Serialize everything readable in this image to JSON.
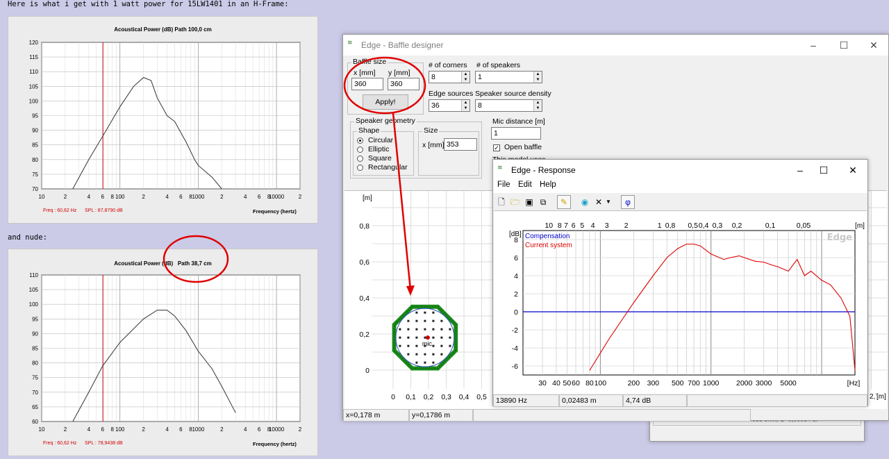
{
  "post": {
    "intro": "Here is what i get with 1 watt power for 15LW1401 in an H-Frame:",
    "nude_label": "and nude:"
  },
  "plot1": {
    "title": "Acoustical Power (dB)   Path 100,0 cm",
    "caption_freq": "Freq : 60,62 Hz",
    "caption_spl": "SPL : 87,8790 dB",
    "xlabel": "Frequency (hertz)",
    "y_ticks": [
      "120",
      "115",
      "110",
      "105",
      "100",
      "95",
      "90",
      "85",
      "80",
      "75",
      "70"
    ],
    "x_ticks": [
      "10",
      "2",
      "4",
      "6",
      "8",
      "100",
      "2",
      "4",
      "6",
      "8",
      "1000",
      "2",
      "4",
      "6",
      "8",
      "10000",
      "2"
    ]
  },
  "plot2": {
    "title_pre": "Acoustical Power (",
    "title_mid": "dB)",
    "title_post": "Path 38,7 cm",
    "caption_freq": "Freq : 60,62 Hz",
    "caption_spl": "SPL : 78,9438 dB",
    "xlabel": "Frequency (hertz)",
    "y_ticks": [
      "110",
      "105",
      "100",
      "95",
      "90",
      "85",
      "80",
      "75",
      "70",
      "65",
      "60"
    ],
    "x_ticks": [
      "10",
      "2",
      "4",
      "6",
      "8",
      "100",
      "2",
      "4",
      "6",
      "8",
      "1000",
      "2",
      "4",
      "6",
      "8",
      "10000",
      "2"
    ]
  },
  "baffle": {
    "title": "Edge - Baffle designer",
    "baffle_size": "Baffle size",
    "x_label": "x [mm]",
    "y_label": "y [mm]",
    "x_value": "360",
    "y_value": "360",
    "apply": "Apply!",
    "corners_label": "# of corners",
    "corners_value": "8",
    "speakers_label": "# of speakers",
    "speakers_value": "1",
    "edge_sources_label": "Edge sources",
    "edge_sources_value": "36",
    "density_label": "Speaker source density",
    "density_value": "8",
    "geometry_label": "Speaker geometry",
    "shape_label": "Shape",
    "shapes": [
      "Circular",
      "Elliptic",
      "Square",
      "Rectangular"
    ],
    "size_label": "Size",
    "size_x_label": "x [mm]",
    "size_x_value": "353",
    "mic_distance_label": "Mic distance [m]",
    "mic_distance_value": "1",
    "open_baffle_label": "Open baffle",
    "model_note": "This model uses",
    "y_axis_unit": "[m]",
    "y_ticks": [
      "0,8",
      "0,6",
      "0,4",
      "0,2",
      "0"
    ],
    "x_ticks": [
      "0",
      "0,1",
      "0,2",
      "0,3",
      "0,4",
      "0,5"
    ],
    "mic_label": "mic",
    "x_right_tick": "2,7",
    "x_unit": "[m]",
    "status_x": "x=0,178 m",
    "status_y": "y=0,1786 m",
    "behind_text": "R2=140088 ohm, C=0,00084 uF",
    "behind_num": "1"
  },
  "response": {
    "title": "Edge - Response",
    "menu": [
      "File",
      "Edit",
      "Help"
    ],
    "legend": [
      "Compensation",
      "Current system"
    ],
    "watermark": "Edge",
    "y_unit": "[dB]",
    "y_ticks": [
      "8",
      "6",
      "4",
      "2",
      "0",
      "-2",
      "-4",
      "-6"
    ],
    "top_unit": "[m]",
    "top_ticks": [
      "10",
      "8",
      "7",
      "6",
      "5",
      "4",
      "3",
      "2",
      "1",
      "0,8",
      "0,5",
      "0,4",
      "0,3",
      "0,2",
      "0,1",
      "0,05"
    ],
    "x_ticks": [
      "30",
      "40",
      "50",
      "60",
      "80",
      "100",
      "200",
      "300",
      "500",
      "700",
      "1000",
      "2000",
      "3000",
      "5000"
    ],
    "x_unit": "[Hz]",
    "status_freq": "13890 Hz",
    "status_dist": "0,02483 m",
    "status_db": "4,74 dB",
    "colors": {
      "compensation": "#0000cc",
      "current": "#dd0000"
    }
  },
  "chart_data": [
    {
      "type": "line",
      "title": "Acoustical Power (dB)   Path 100,0 cm",
      "xlabel": "Frequency (hertz)",
      "ylim": [
        70,
        120
      ],
      "xlim": [
        10,
        20000
      ],
      "x_scale": "log",
      "series": [
        {
          "x": [
            25,
            40,
            60,
            100,
            150,
            200,
            250,
            300,
            400,
            500,
            700,
            900,
            1000,
            1500,
            2000
          ],
          "values": [
            70,
            80,
            87.9,
            98,
            105,
            108,
            107,
            101,
            95,
            93,
            86,
            80,
            78,
            74,
            70
          ]
        }
      ]
    },
    {
      "type": "line",
      "title": "Acoustical Power (dB)   Path 38,7 cm",
      "xlabel": "Frequency (hertz)",
      "ylim": [
        60,
        110
      ],
      "xlim": [
        10,
        20000
      ],
      "x_scale": "log",
      "series": [
        {
          "x": [
            25,
            40,
            60,
            100,
            200,
            300,
            400,
            500,
            700,
            1000,
            1500,
            2000,
            3000
          ],
          "values": [
            60,
            70,
            78.9,
            87,
            95,
            98,
            98,
            96,
            91,
            84,
            78,
            72,
            63
          ]
        }
      ]
    },
    {
      "type": "line",
      "ylabel": "[dB]",
      "xlabel": "[Hz]",
      "ylim": [
        -7,
        9
      ],
      "xlim": [
        20,
        20000
      ],
      "x_scale": "log",
      "series": [
        {
          "name": "Compensation",
          "x": [
            20,
            20000
          ],
          "values": [
            0,
            0
          ]
        },
        {
          "name": "Current system",
          "x": [
            80,
            120,
            200,
            300,
            400,
            500,
            600,
            700,
            800,
            1000,
            1300,
            1500,
            1800,
            2000,
            2500,
            3000,
            3500,
            4000,
            5000,
            6000,
            7000,
            8000,
            10000,
            12000,
            15000,
            18000,
            20000
          ],
          "values": [
            -6.5,
            -3,
            1,
            4,
            6,
            7,
            7.5,
            7.5,
            7.3,
            6.4,
            5.8,
            6,
            6.2,
            6,
            5.6,
            5.5,
            5.2,
            5,
            4.5,
            5.8,
            4,
            4.5,
            3.5,
            3,
            1.5,
            -0.5,
            -6.5
          ]
        }
      ]
    }
  ]
}
